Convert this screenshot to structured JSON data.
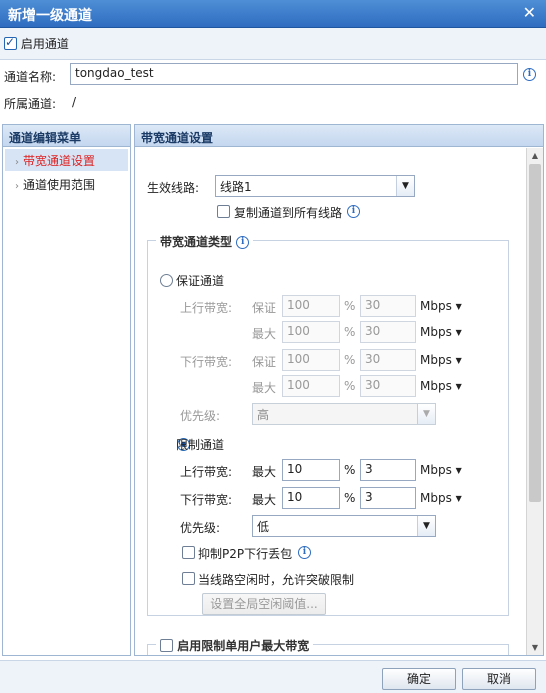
{
  "window": {
    "title": "新增一级通道",
    "close": "✕"
  },
  "enable": {
    "label": "启用通道",
    "checked": true
  },
  "name": {
    "label": "通道名称:",
    "value": "tongdao_test"
  },
  "parent": {
    "label": "所属通道:",
    "value": "/"
  },
  "menu": {
    "title": "通道编辑菜单",
    "items": [
      {
        "label": "带宽通道设置",
        "selected": true
      },
      {
        "label": "通道使用范围",
        "selected": false
      }
    ]
  },
  "settings": {
    "title": "带宽通道设置",
    "line_label": "生效线路:",
    "line_value": "线路1",
    "copy_label": "复制通道到所有线路",
    "type_legend": "带宽通道类型",
    "guarantee": {
      "label": "保证通道",
      "up_label": "上行带宽:",
      "down_label": "下行带宽:",
      "guarantee_word": "保证",
      "max_word": "最大",
      "up_g": "100",
      "up_g2": "30",
      "up_m": "100",
      "up_m2": "30",
      "down_g": "100",
      "down_g2": "30",
      "down_m": "100",
      "down_m2": "30",
      "priority_label": "优先级:",
      "priority_value": "高"
    },
    "limit": {
      "label": "限制通道",
      "up_label": "上行带宽:",
      "down_label": "下行带宽:",
      "max_word": "最大",
      "up_pct": "10",
      "up_val": "3",
      "down_pct": "10",
      "down_val": "3",
      "priority_label": "优先级:",
      "priority_value": "低",
      "p2p_label": "抑制P2P下行丢包",
      "idle_label": "当线路空闲时，允许突破限制",
      "idle_button": "设置全局空闲阈值..."
    },
    "percent": "%",
    "unit": "Mbps",
    "single_user_label": "启用限制单用户最大带宽"
  },
  "footer": {
    "ok": "确定",
    "cancel": "取消"
  }
}
